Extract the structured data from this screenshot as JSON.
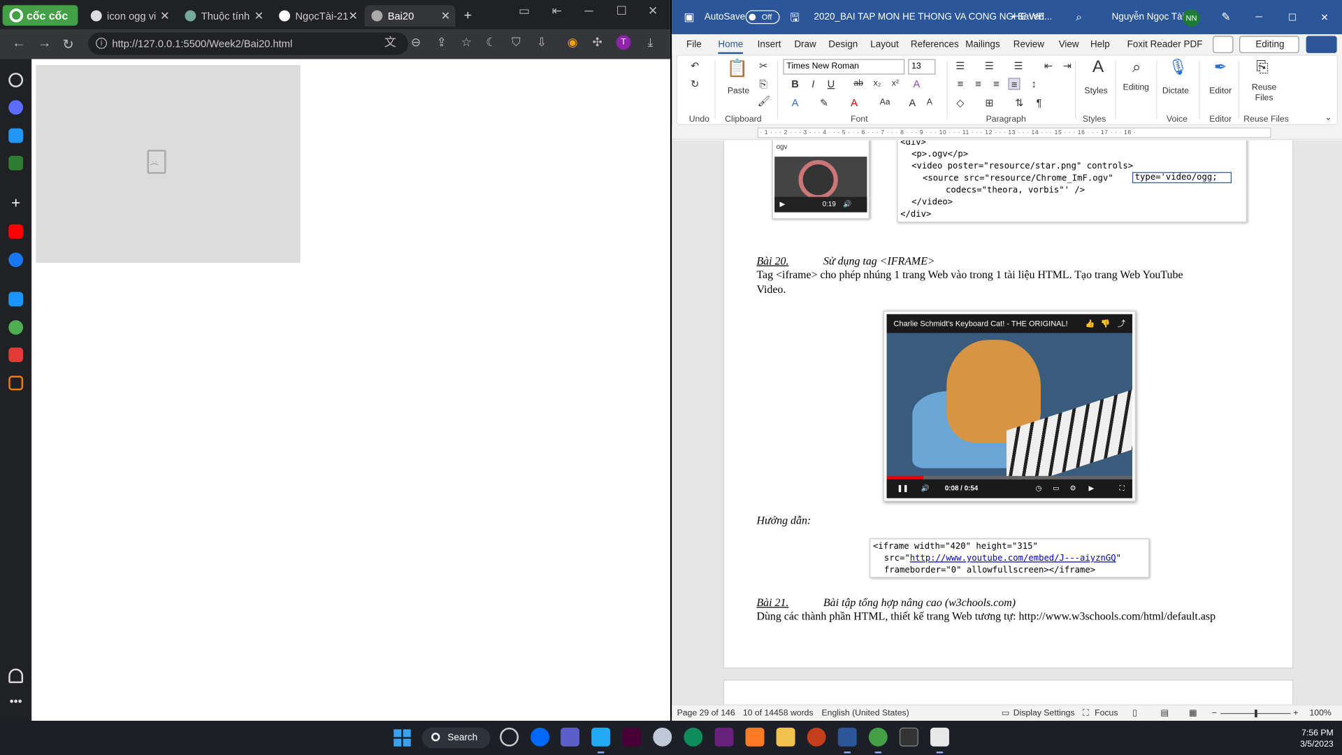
{
  "browser": {
    "brand": "cốc cốc",
    "tabs": [
      {
        "title": "icon ogg vi"
      },
      {
        "title": "Thuộc tính"
      },
      {
        "title": "NgọcTài-21"
      },
      {
        "title": "Bai20"
      }
    ],
    "new_tab": "+",
    "url": "http://127.0.0.1:5500/Week2/Bai20.html",
    "profile_initial": "T"
  },
  "word": {
    "autosave_label": "AutoSave",
    "autosave_state": "Off",
    "doc_title": "2020_BAI TAP MON HE THONG VA CONG NGHE WE...",
    "saved_label": "• Saved",
    "user_name": "Nguyễn Ngọc Tài",
    "user_initials": "NN",
    "menu": [
      "File",
      "Home",
      "Insert",
      "Draw",
      "Design",
      "Layout",
      "References",
      "Mailings",
      "Review",
      "View",
      "Help",
      "Foxit Reader PDF"
    ],
    "editing_button": "Editing",
    "ribbon": {
      "font_name": "Times New Roman",
      "font_size": "13",
      "paste": "Paste",
      "styles": "Styles",
      "editing": "Editing",
      "dictate": "Dictate",
      "editor": "Editor",
      "reuse_files": "Reuse Files",
      "groups": {
        "undo": "Undo",
        "clipboard": "Clipboard",
        "font": "Font",
        "paragraph": "Paragraph",
        "styles": "Styles",
        "voice": "Voice",
        "editor": "Editor",
        "reuse": "Reuse Files"
      }
    },
    "ruler": "· 1 · ·  · 2 · ·  · 3 · ·  · 4 · ·  · 5 · ·  · 6 · ·  · 7 · ·  · 8 · ·  · 9 · ·  · 10 · ·  · 11 · ·  · 12 · ·  · 13 · ·  · 14 · ·  · 15 · ·  · 16 · ·  · 17 · ·  · 18 ·",
    "ogv_image": {
      "label": "ogv",
      "time": "0:19"
    },
    "code_top": {
      "l1": "<div>",
      "l2": "<p>.ogv</p>",
      "l3": "<video poster=\"resource/star.png\" controls>",
      "l4a": "<source src=\"resource/Chrome_ImF.ogv\"",
      "l4b": "type='video/ogg;",
      "l5": "codecs=\"theora, vorbis\"' />",
      "l6": "</video>",
      "l7": "</div>"
    },
    "bai20": {
      "heading": "Bài 20.",
      "title": "Sử dụng tag <IFRAME>",
      "body_line1": "Tag <iframe> cho phép nhúng 1 trang Web vào trong 1 tài liệu HTML.  Tạo trang Web YouTube",
      "body_line2": "Video."
    },
    "youtube": {
      "title": "Charlie Schmidt's Keyboard Cat! - THE ORIGINAL!",
      "time": "0:08 / 0:54",
      "progress": 0.15
    },
    "huong_dan": "Hướng dẫn:",
    "code_iframe": {
      "l1": "<iframe width=\"420\" height=\"315\"",
      "l2a": "src=\"",
      "l2b": "http://www.youtube.com/embed/J---aiyznGQ",
      "l2c": "\"",
      "l3": "frameborder=\"0\" allowfullscreen></iframe>"
    },
    "bai21": {
      "heading": "Bài 21.",
      "title": "Bài tập tổng hợp nâng cao (w3chools.com)",
      "body": "Dùng các thành phần HTML, thiết kế trang Web tương tự: http://www.w3schools.com/html/default.asp"
    },
    "status": {
      "page": "Page 29 of 146",
      "words": "10 of 14458 words",
      "language": "English (United States)",
      "display_settings": "Display Settings",
      "focus": "Focus",
      "zoom": "100%"
    }
  },
  "taskbar": {
    "search": "Search",
    "time": "7:56 PM",
    "date": "3/5/2023"
  },
  "colors": {
    "word_blue": "#2b579a",
    "browser_dark": "#202124",
    "coccoc_green": "#43a047",
    "taskbar": "#1c1f26"
  }
}
